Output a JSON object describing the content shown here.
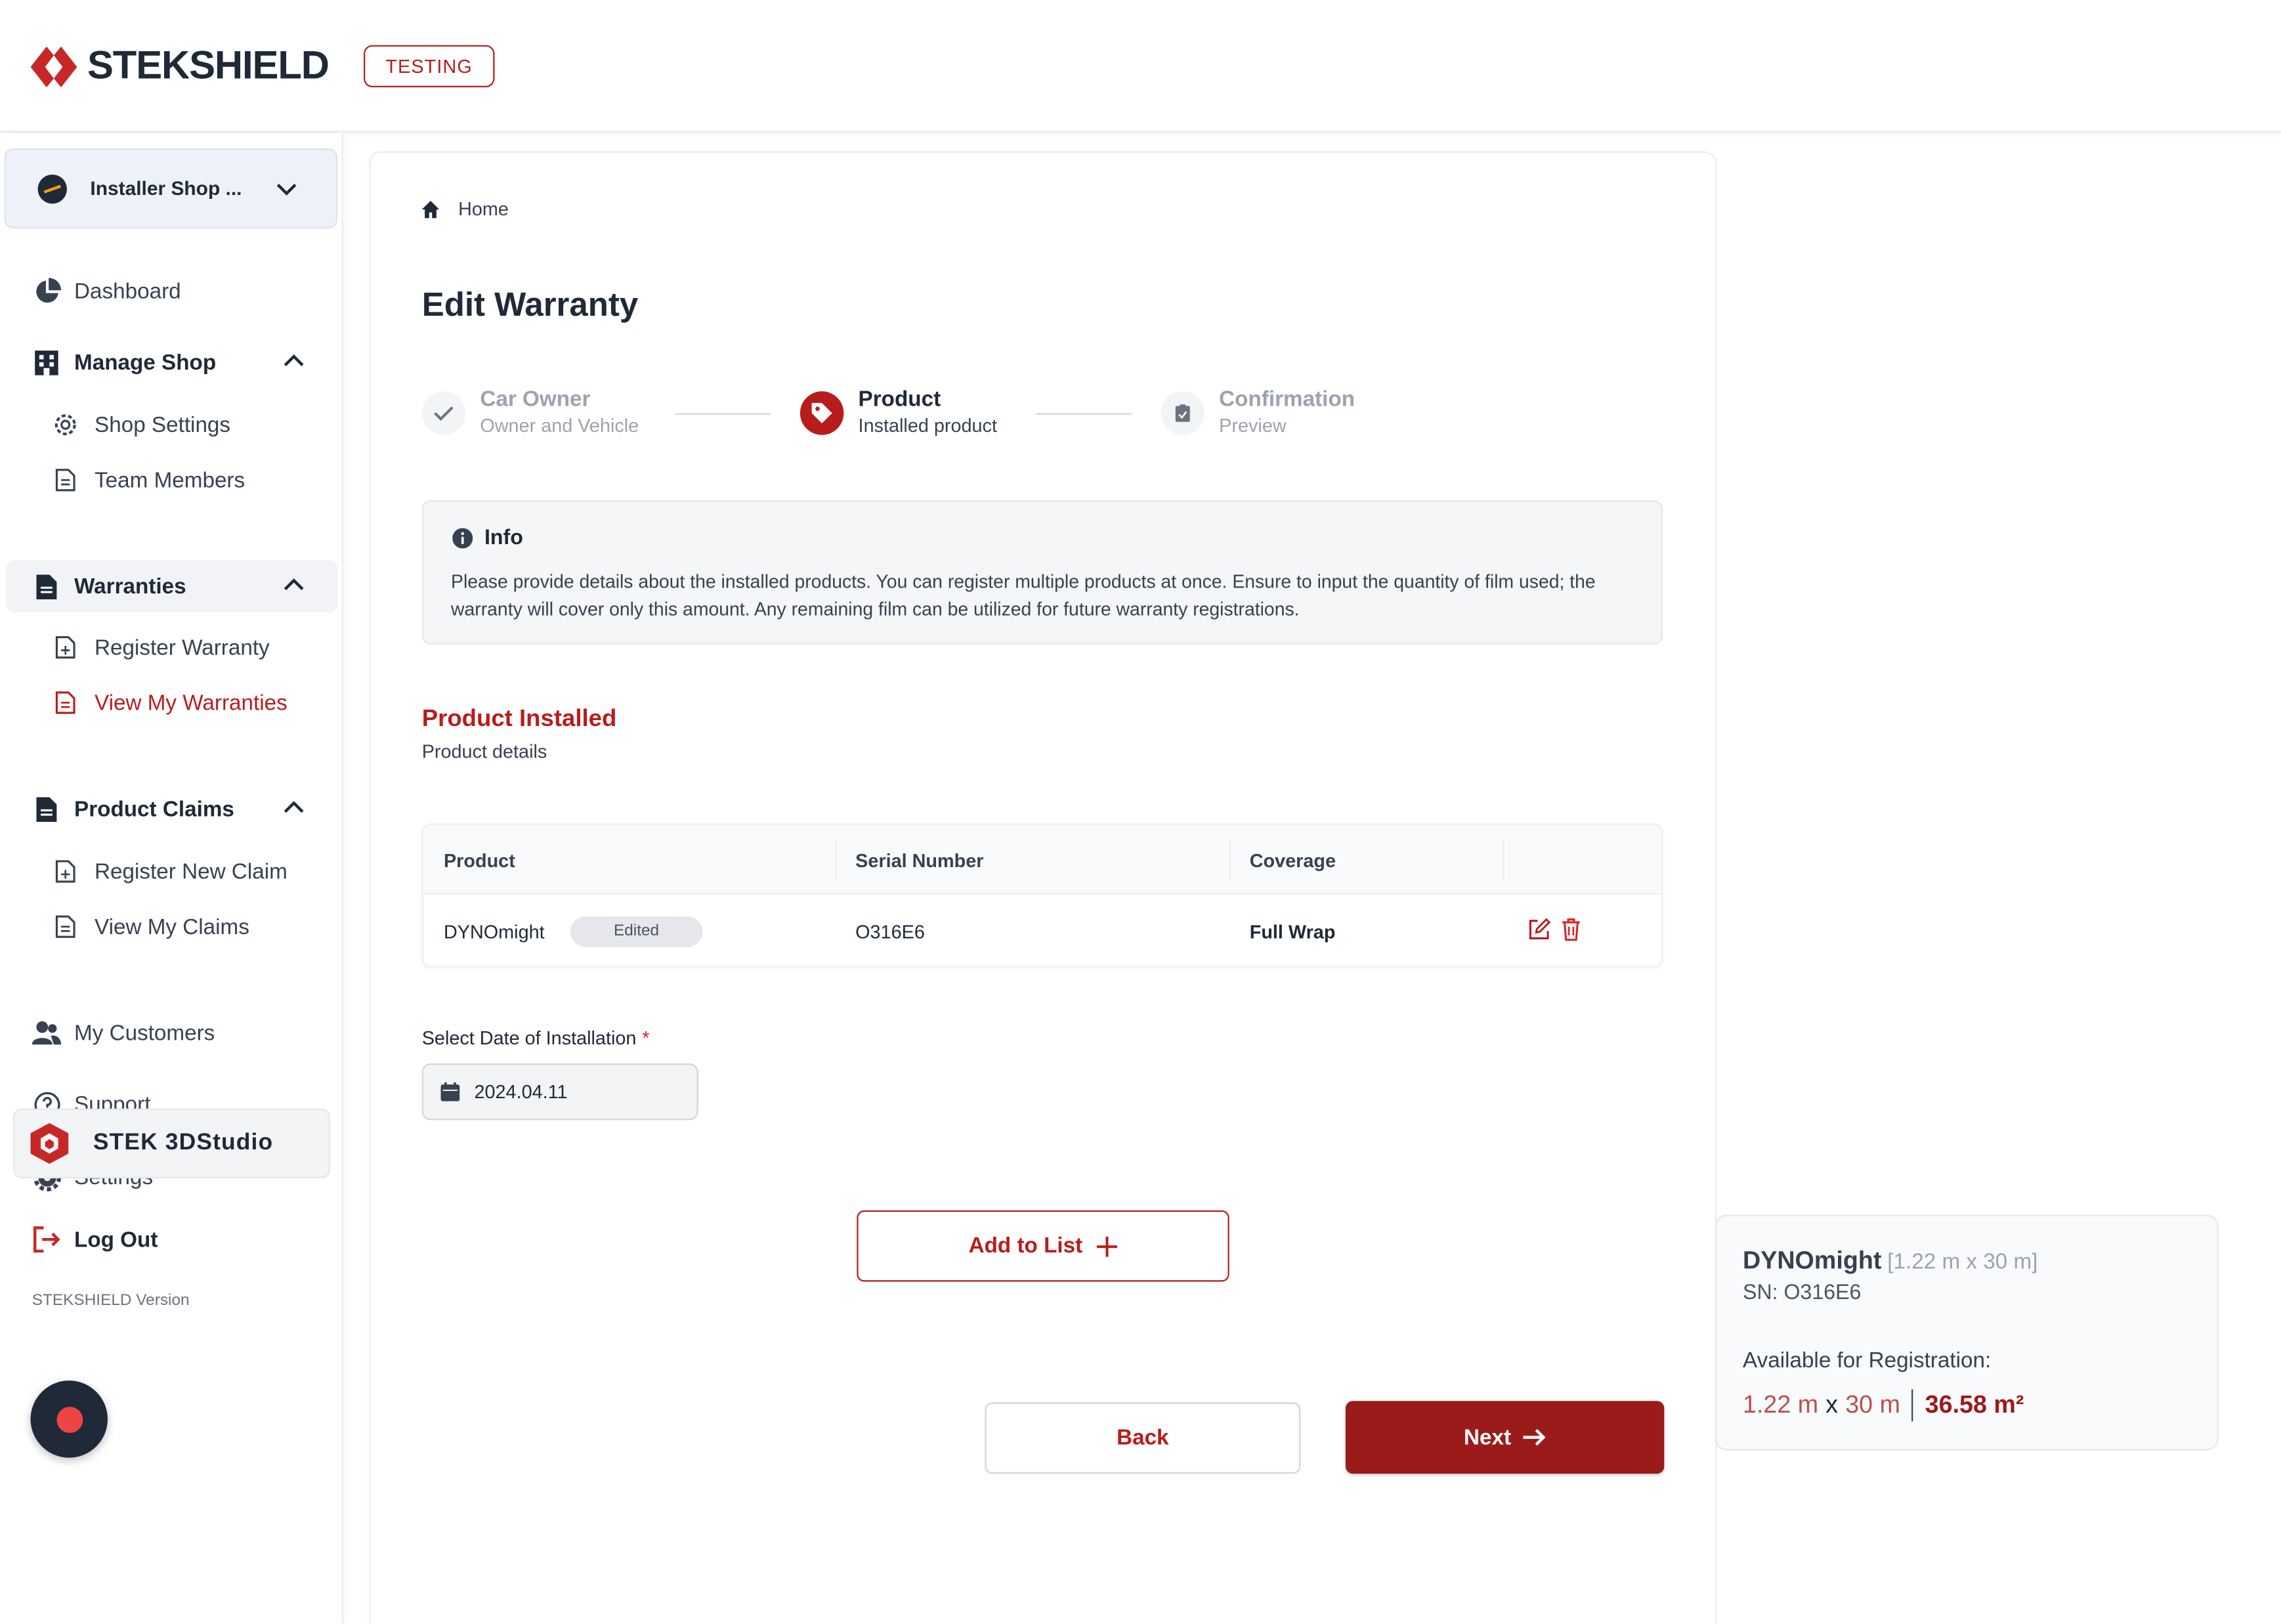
{
  "header": {
    "brand": "STEKSHIELD",
    "env_badge": "TESTING"
  },
  "sidebar": {
    "shop_selector": "Installer Shop ...",
    "dashboard": "Dashboard",
    "manage_shop": {
      "label": "Manage Shop",
      "items": [
        "Shop Settings",
        "Team Members"
      ]
    },
    "warranties": {
      "label": "Warranties",
      "items": [
        "Register Warranty",
        "View My Warranties"
      ],
      "active_item": "View My Warranties"
    },
    "product_claims": {
      "label": "Product Claims",
      "items": [
        "Register New Claim",
        "View My Claims"
      ]
    },
    "my_customers": "My Customers",
    "support": "Support",
    "settings": "Settings",
    "studio": "STEK 3DStudio",
    "logout": "Log Out",
    "version": "STEKSHIELD Version"
  },
  "breadcrumb": {
    "home": "Home"
  },
  "page_title": "Edit Warranty",
  "stepper": [
    {
      "title": "Car Owner",
      "subtitle": "Owner and Vehicle",
      "state": "completed"
    },
    {
      "title": "Product",
      "subtitle": "Installed product",
      "state": "current"
    },
    {
      "title": "Confirmation",
      "subtitle": "Preview",
      "state": "upcoming"
    }
  ],
  "info": {
    "title": "Info",
    "body": "Please provide details about the installed products. You can register multiple products at once. Ensure to input the quantity of film used; the warranty will cover only this amount. Any remaining film can be utilized for future warranty registrations."
  },
  "section": {
    "title": "Product Installed",
    "subtitle": "Product details"
  },
  "table": {
    "columns": [
      "Product",
      "Serial Number",
      "Coverage"
    ],
    "rows": [
      {
        "product": "DYNOmight",
        "badge": "Edited",
        "serial": "O316E6",
        "coverage": "Full Wrap"
      }
    ]
  },
  "date_field": {
    "label": "Select Date of Installation",
    "required_mark": "*",
    "value": "2024.04.11"
  },
  "buttons": {
    "add": "Add to List",
    "back": "Back",
    "next": "Next"
  },
  "summary": {
    "name": "DYNOmight",
    "dimensions": "[1.22 m x 30 m]",
    "serial": "SN: O316E6",
    "available_label": "Available for Registration:",
    "width": "1.22 m",
    "times": "x",
    "length": "30 m",
    "area": "36.58 m²"
  },
  "colors": {
    "brand_red": "#9b1b1b",
    "accent_red": "#b91c1c",
    "text_dark": "#1f2937"
  }
}
